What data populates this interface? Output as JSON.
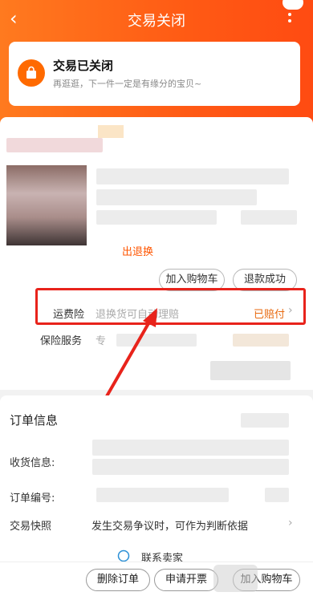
{
  "header": {
    "back_icon": "‹",
    "title": "交易关闭",
    "status_title": "交易已关闭",
    "status_subtitle": "再逛逛，下一件一定是有缘分的宝贝~"
  },
  "item": {
    "refund_link": "出退换",
    "add_cart_label": "加入购物车",
    "refund_status_label": "退款成功"
  },
  "shipping_insurance": {
    "label": "运费险",
    "hint": "退换货可自动理赔",
    "status": "已赔付",
    "chevron": "›"
  },
  "insurance_service": {
    "label": "保险服务",
    "hint": "专"
  },
  "order_info": {
    "title": "订单信息",
    "receiver_label": "收货信息:",
    "order_no_label": "订单编号:",
    "snapshot_label": "交易快照",
    "snapshot_value": "发生交易争议时，可作为判断依据",
    "snapshot_chevron": "›",
    "contact_text": "联系卖家"
  },
  "bottom_bar": {
    "delete_label": "删除订单",
    "invoice_label": "申请开票",
    "add_cart_label": "加入购物车"
  },
  "colors": {
    "header_orange": "#ff5a14",
    "accent": "#ff5500",
    "annotation_red": "#e8231b"
  }
}
